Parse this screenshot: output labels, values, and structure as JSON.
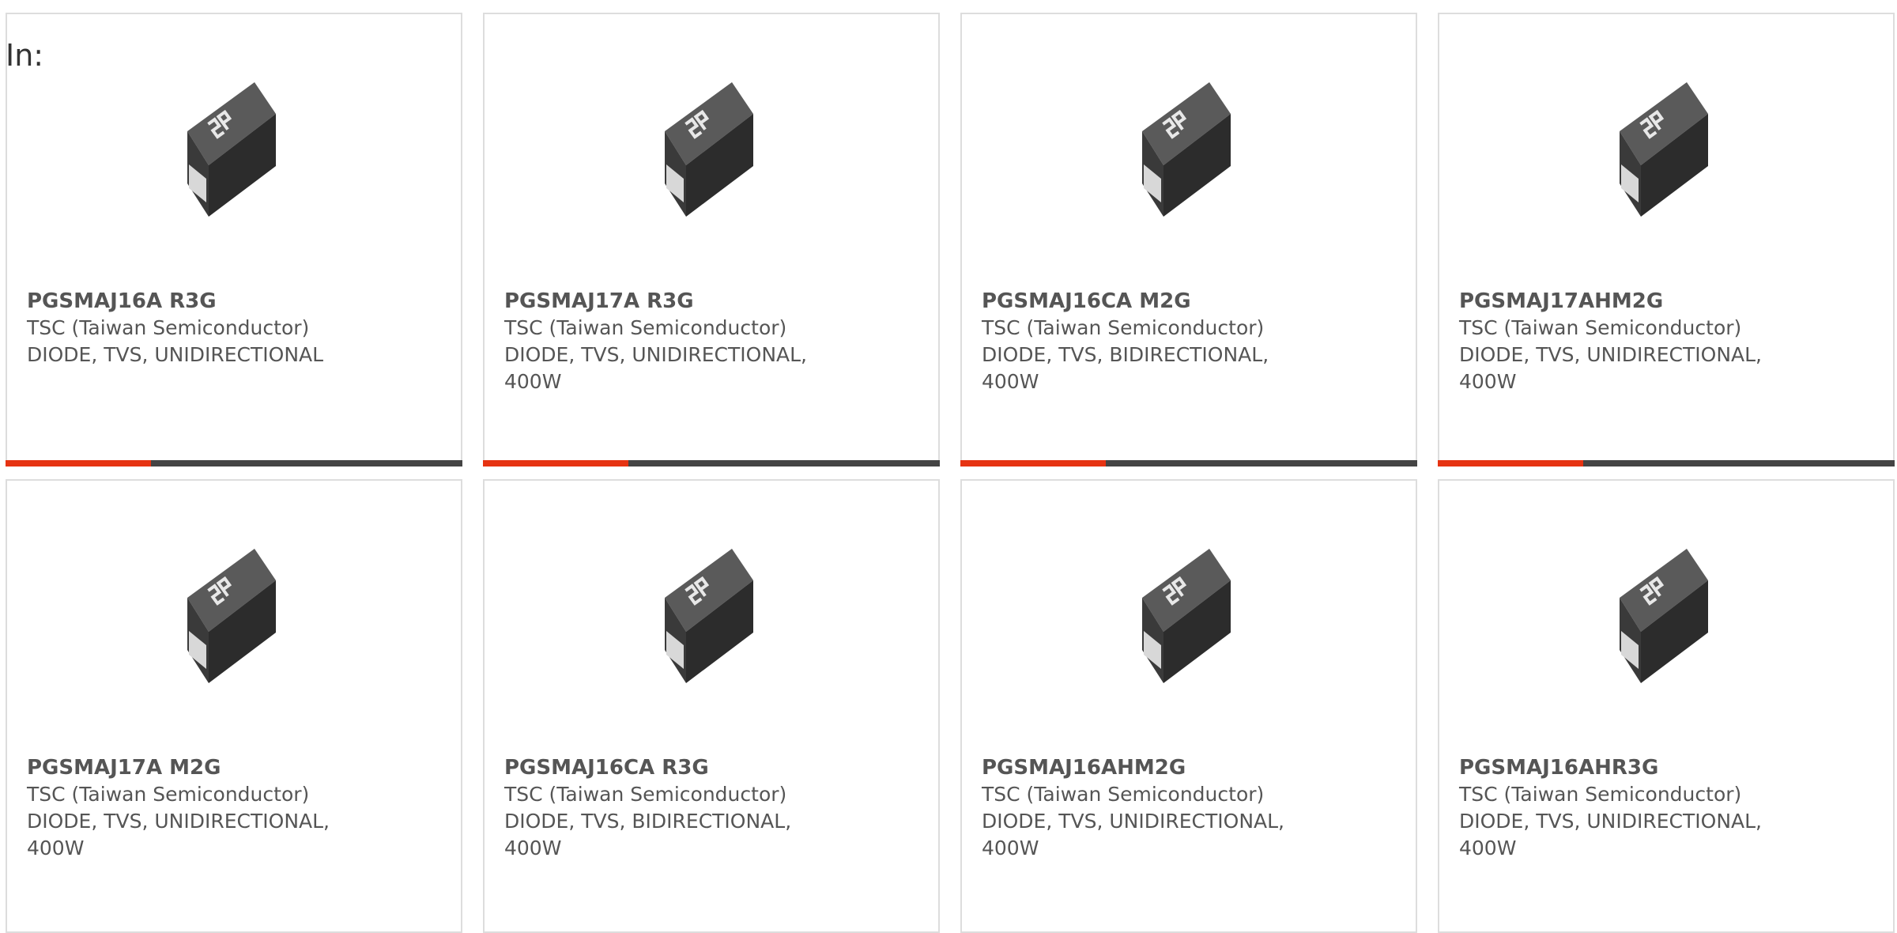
{
  "header": {
    "in_label": "In:"
  },
  "colors": {
    "accent": "#e63312",
    "bar": "#444444",
    "text": "#555555",
    "border": "#dddddd"
  },
  "product_icon": "smd-diode-package-icon",
  "products": [
    {
      "part_number": "PGSMAJ16A R3G",
      "manufacturer": "TSC (Taiwan Semiconductor)",
      "description_line1": "DIODE, TVS, UNIDIRECTIONAL",
      "description_line2": ""
    },
    {
      "part_number": "PGSMAJ17A R3G",
      "manufacturer": "TSC (Taiwan Semiconductor)",
      "description_line1": "DIODE, TVS, UNIDIRECTIONAL,",
      "description_line2": "400W"
    },
    {
      "part_number": "PGSMAJ16CA M2G",
      "manufacturer": "TSC (Taiwan Semiconductor)",
      "description_line1": "DIODE, TVS, BIDIRECTIONAL,",
      "description_line2": "400W"
    },
    {
      "part_number": "PGSMAJ17AHM2G",
      "manufacturer": "TSC (Taiwan Semiconductor)",
      "description_line1": "DIODE, TVS, UNIDIRECTIONAL,",
      "description_line2": "400W"
    },
    {
      "part_number": "PGSMAJ17A M2G",
      "manufacturer": "TSC (Taiwan Semiconductor)",
      "description_line1": "DIODE, TVS, UNIDIRECTIONAL,",
      "description_line2": "400W"
    },
    {
      "part_number": "PGSMAJ16CA R3G",
      "manufacturer": "TSC (Taiwan Semiconductor)",
      "description_line1": "DIODE, TVS, BIDIRECTIONAL,",
      "description_line2": "400W"
    },
    {
      "part_number": "PGSMAJ16AHM2G",
      "manufacturer": "TSC (Taiwan Semiconductor)",
      "description_line1": "DIODE, TVS, UNIDIRECTIONAL,",
      "description_line2": "400W"
    },
    {
      "part_number": "PGSMAJ16AHR3G",
      "manufacturer": "TSC (Taiwan Semiconductor)",
      "description_line1": "DIODE, TVS, UNIDIRECTIONAL,",
      "description_line2": "400W"
    }
  ]
}
